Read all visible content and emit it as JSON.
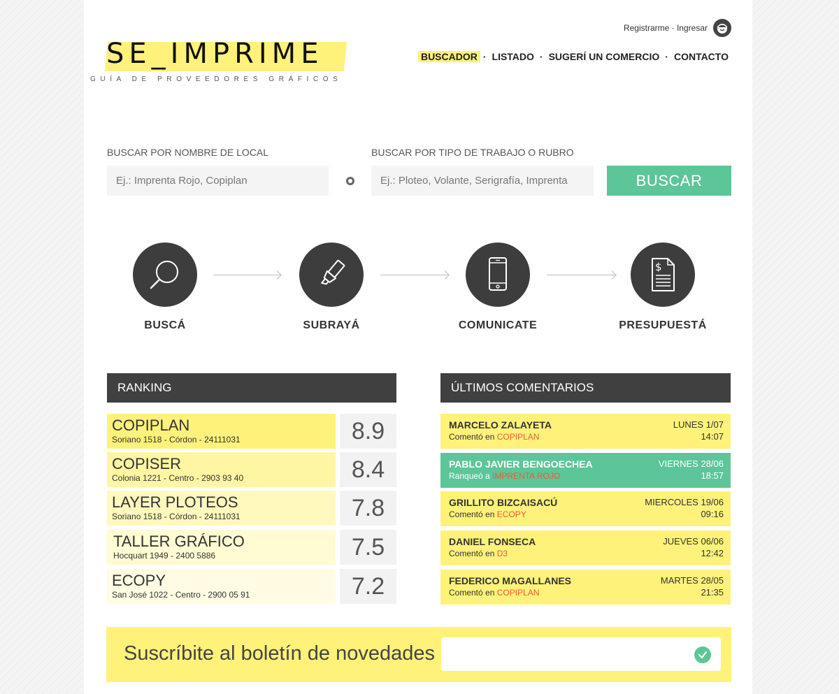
{
  "header": {
    "register": "Registrarme",
    "separator": " · ",
    "login": "Ingresar",
    "logo": "SE_IMPRIME",
    "tagline": "GUÍA DE PROVEEDORES GRÁFICOS",
    "nav": [
      {
        "label": "BUSCADOR",
        "active": true
      },
      {
        "label": "LISTADO"
      },
      {
        "label": "SUGERÍ UN COMERCIO"
      },
      {
        "label": "CONTACTO"
      }
    ],
    "nav_separator": "·"
  },
  "search": {
    "name_label": "BUSCAR POR NOMBRE DE LOCAL",
    "name_placeholder": "Ej.: Imprenta Rojo, Copiplan",
    "type_label": "BUSCAR POR TIPO DE TRABAJO O RUBRO",
    "type_placeholder": "Ej.: Ploteo, Volante, Serigrafía, Imprenta",
    "button": "BUSCAR"
  },
  "steps": [
    {
      "label": "BUSCÁ",
      "icon": "search-icon"
    },
    {
      "label": "SUBRAYÁ",
      "icon": "highlighter-icon"
    },
    {
      "label": "COMUNICATE",
      "icon": "phone-icon"
    },
    {
      "label": "PRESUPUESTÁ",
      "icon": "invoice-icon"
    }
  ],
  "ranking": {
    "title": "RANKING",
    "items": [
      {
        "name": "COPIPLAN",
        "address": "Soriano 1518 - Córdon - 24111031",
        "score": "8.9",
        "color": "#fff27a"
      },
      {
        "name": "COPISER",
        "address": "Colonia 1221 - Centro - 2903 93 40",
        "score": "8.4",
        "color": "#fff6a3"
      },
      {
        "name": "LAYER PLOTEOS",
        "address": "Soriano 1518 - Córdon - 24111031",
        "score": "7.8",
        "color": "#fff9bd"
      },
      {
        "name": "TALLER GRÁFICO",
        "address": "Hocquart 1949 - 2400 5886",
        "score": "7.5",
        "color": "#fffbd2"
      },
      {
        "name": "ECOPY",
        "address": "San José 1022 - Centro - 2900 05 91",
        "score": "7.2",
        "color": "#fffce3"
      }
    ]
  },
  "comments": {
    "title": "ÚLTIMOS COMENTARIOS",
    "items": [
      {
        "name": "MARCELO ZALAYETA",
        "action": "Comentó en",
        "target": "COPIPLAN",
        "day": "LUNES 1/07",
        "time": "14:07",
        "highlight": false
      },
      {
        "name": "PABLO JAVIER BENGOECHEA",
        "action": "Ranqueó a",
        "target": "IMPRENTA ROJO",
        "day": "VIERNES 28/06",
        "time": "18:57",
        "highlight": true
      },
      {
        "name": "GRILLITO BIZCAISACÚ",
        "action": "Comentó en",
        "target": "ECOPY",
        "day": "MIERCOLES 19/06",
        "time": "09:16",
        "highlight": false
      },
      {
        "name": "DANIEL FONSECA",
        "action": "Comentó en",
        "target": "D3",
        "day": "JUEVES 06/06",
        "time": "12:42",
        "highlight": false
      },
      {
        "name": "FEDERICO MAGALLANES",
        "action": "Comentó en",
        "target": "COPIPLAN",
        "day": "MARTES 28/05",
        "time": "21:35",
        "highlight": false
      }
    ]
  },
  "newsletter": {
    "title": "Suscríbite al boletín de novedades",
    "placeholder": "",
    "submit_icon": "check-icon"
  },
  "colors": {
    "accent_yellow": "#fff27a",
    "accent_green": "#5cc699",
    "dark": "#404040",
    "link_red": "#f15a3a"
  }
}
